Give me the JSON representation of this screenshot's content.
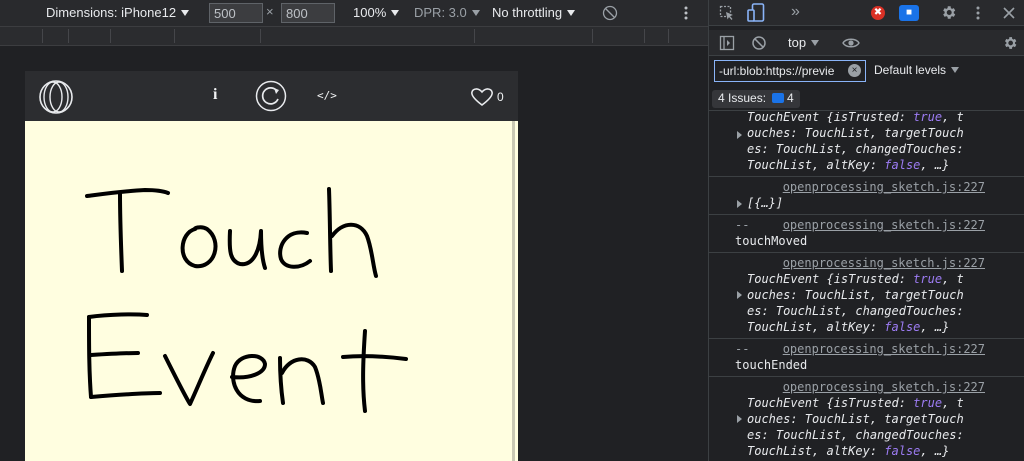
{
  "device_toolbar": {
    "dimensions_label": "Dimensions: iPhone12",
    "width": "500",
    "times": "×",
    "height": "800",
    "zoom": "100%",
    "dpr": "DPR: 3.0",
    "throttling": "No throttling",
    "rotate_icon": "rotate-icon",
    "more_icon": "more-vert-icon"
  },
  "sketch_header": {
    "logo_icon": "openprocessing-logo-icon",
    "info_label": "i",
    "reload_icon": "reload-icon",
    "code_label": "</>",
    "heart_icon": "heart-icon",
    "like_count": "0"
  },
  "canvas": {
    "drawn_text_lines": [
      "Touch",
      "Event"
    ],
    "background_color": "#fffee0",
    "ink_color": "#000000"
  },
  "devtools": {
    "top_tabs": {
      "more_tabs": "»",
      "error_badge": "✖",
      "message_badge": "■"
    },
    "console_toolbar": {
      "context": "top"
    },
    "filter": {
      "value": "-url:blob:https://previe",
      "clear_icon": "×"
    },
    "levels": "Default levels",
    "issues": {
      "label": "4 Issues:",
      "count": "4"
    },
    "console": {
      "source": "openprocessing_sketch.js:227",
      "touch_event_lines": [
        "TouchEvent {isTrusted: true, t",
        "ouches: TouchList, targetTouch",
        "es: TouchList, changedTouches:",
        "TouchList, altKey: false, …}"
      ],
      "array_summary": "[{…}]",
      "separator": "--",
      "touch_moved": "touchMoved",
      "touch_ended": "touchEnded"
    }
  }
}
